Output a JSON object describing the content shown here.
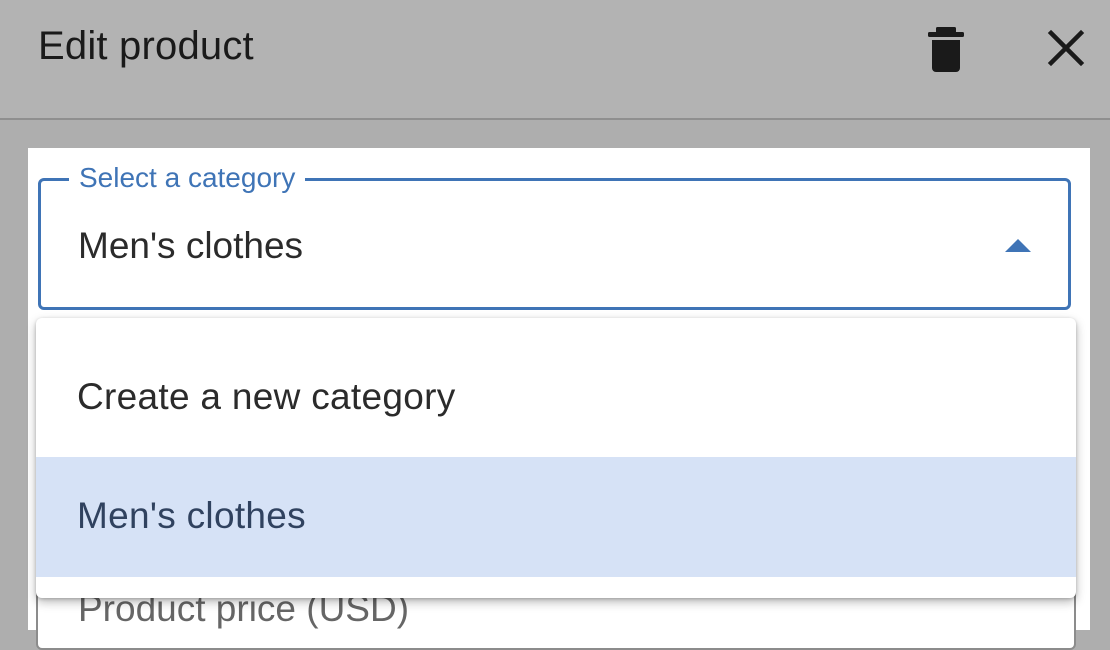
{
  "dialog": {
    "title": "Edit product"
  },
  "icons": {
    "delete": "trash-icon",
    "close": "close-icon",
    "dropdown": "caret-up-icon"
  },
  "category_select": {
    "label": "Select a category",
    "value": "Men's clothes"
  },
  "menu": {
    "items": [
      {
        "label": "Create a new category",
        "selected": false
      },
      {
        "label": "Men's clothes",
        "selected": true
      }
    ]
  },
  "price_field": {
    "label": "Product price (USD)"
  },
  "colors": {
    "accent": "#3f74b6",
    "selected_bg": "#d6e2f6",
    "scrim": "#aeaeae"
  }
}
